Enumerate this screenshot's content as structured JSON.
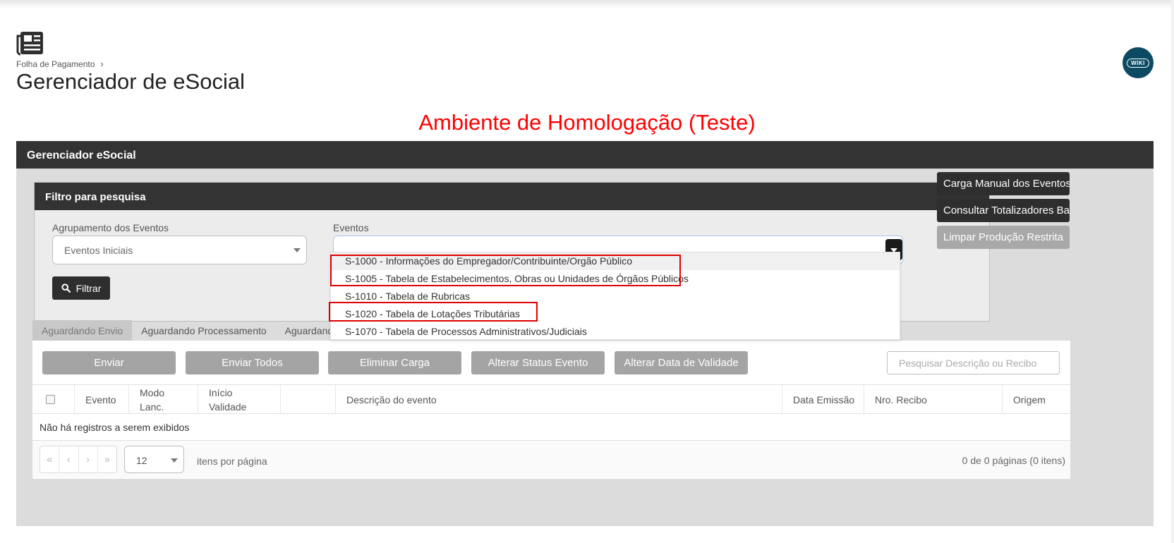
{
  "header": {
    "breadcrumb": "Folha de Pagamento",
    "title": "Gerenciador de eSocial",
    "wiki_label": "WIKI"
  },
  "environment_banner": "Ambiente de Homologação (Teste)",
  "main_panel": {
    "title": "Gerenciador eSocial"
  },
  "filter": {
    "title": "Filtro para pesquisa",
    "grouping_label": "Agrupamento dos Eventos",
    "grouping_value": "Eventos Iniciais",
    "events_label": "Eventos",
    "filter_button": "Filtrar"
  },
  "side_actions": [
    {
      "label": "Carga Manual dos Eventos",
      "enabled": true
    },
    {
      "label": "Consultar Totalizadores Base",
      "enabled": true
    },
    {
      "label": "Limpar Produção Restrita",
      "enabled": false
    }
  ],
  "tabs": [
    {
      "label": "Aguardando Envio",
      "active": true
    },
    {
      "label": "Aguardando Processamento",
      "active": false
    },
    {
      "label": "Aguardando C",
      "active": false
    }
  ],
  "actions": {
    "enviar": "Enviar",
    "enviar_todos": "Enviar Todos",
    "eliminar_carga": "Eliminar Carga",
    "alterar_status": "Alterar Status Evento",
    "alterar_data": "Alterar Data de Validade",
    "search_placeholder": "Pesquisar Descrição ou Recibo"
  },
  "table": {
    "columns": {
      "evento": "Evento",
      "modo_lanc": "Modo Lanc.",
      "inicio_validade": "Início Validade",
      "descricao": "Descrição do evento",
      "data_emissao": "Data Emissão",
      "nro_recibo": "Nro. Recibo",
      "origem": "Origem"
    },
    "empty_message": "Não há registros a serem exibidos"
  },
  "pager": {
    "first": "«",
    "prev": "‹",
    "next": "›",
    "last": "»",
    "page_size": "12",
    "per_page_label": "itens por página",
    "info": "0 de 0 páginas (0 itens)"
  },
  "events_dropdown": [
    "S-1000 - Informações do Empregador/Contribuinte/Orgão Público",
    "S-1005 - Tabela de Estabelecimentos, Obras ou Unidades de Órgãos Públicos",
    "S-1010 - Tabela de Rubricas",
    "S-1020 - Tabela de Lotações Tributárias",
    "S-1070 - Tabela de Processos Administrativos/Judiciais"
  ],
  "colors": {
    "dark_header": "#333333",
    "banner_red": "#ff0000",
    "highlight_red": "#e00000",
    "wiki_blue": "#0c4a63",
    "disabled_button": "#a4a4a4"
  },
  "icons": {
    "header": "newspaper-icon",
    "filter_button": "search-icon",
    "breadcrumb_separator": "chevron-right-icon"
  }
}
